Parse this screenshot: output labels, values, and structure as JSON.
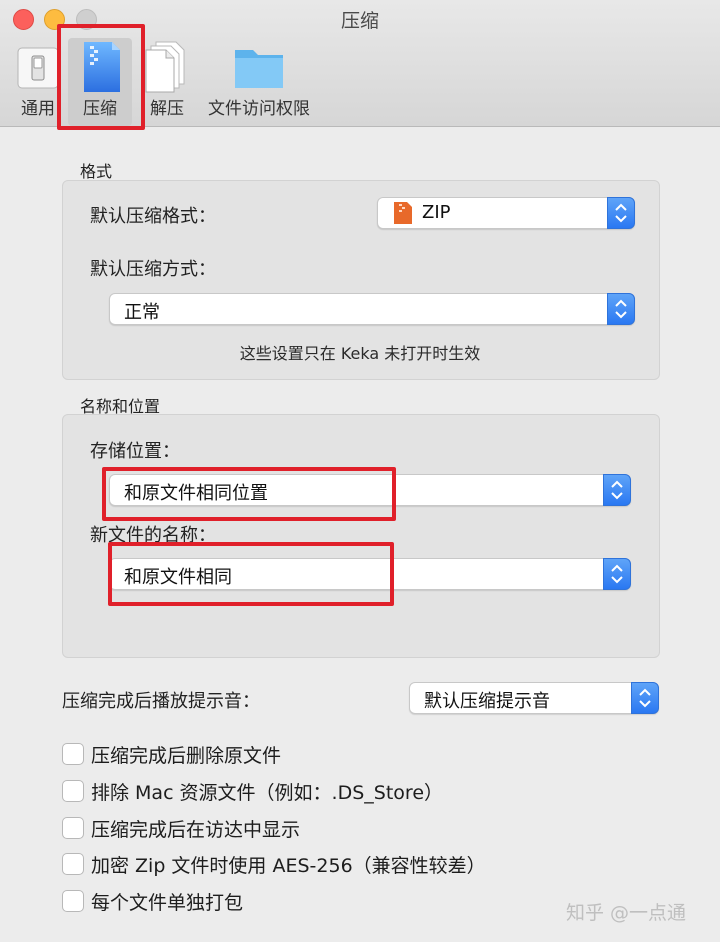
{
  "window": {
    "title": "压缩"
  },
  "toolbar": [
    {
      "label": "通用",
      "icon": "switch-icon"
    },
    {
      "label": "压缩",
      "icon": "zip-file-icon",
      "selected": true
    },
    {
      "label": "解压",
      "icon": "documents-icon"
    },
    {
      "label": "文件访问权限",
      "icon": "folder-icon"
    }
  ],
  "format_section": {
    "title": "格式",
    "default_format_label": "默认压缩格式：",
    "default_format_value": "ZIP",
    "default_method_label": "默认压缩方式：",
    "default_method_value": "正常",
    "hint": "这些设置只在 Keka 未打开时生效"
  },
  "location_section": {
    "title": "名称和位置",
    "save_location_label": "存储位置：",
    "save_location_value": "和原文件相同位置",
    "new_name_label": "新文件的名称：",
    "new_name_value": "和原文件相同"
  },
  "sound": {
    "label": "压缩完成后播放提示音：",
    "value": "默认压缩提示音"
  },
  "options": [
    {
      "label": "压缩完成后删除原文件",
      "checked": false
    },
    {
      "label": "排除 Mac 资源文件（例如：.DS_Store）",
      "checked": false
    },
    {
      "label": "压缩完成后在访达中显示",
      "checked": false
    },
    {
      "label": "加密 Zip 文件时使用 AES-256（兼容性较差）",
      "checked": false
    },
    {
      "label": "每个文件单独打包",
      "checked": false
    }
  ],
  "watermark": "知乎 @一点通",
  "colors": {
    "accent": "#2a78f2",
    "highlight": "#e0202a"
  }
}
